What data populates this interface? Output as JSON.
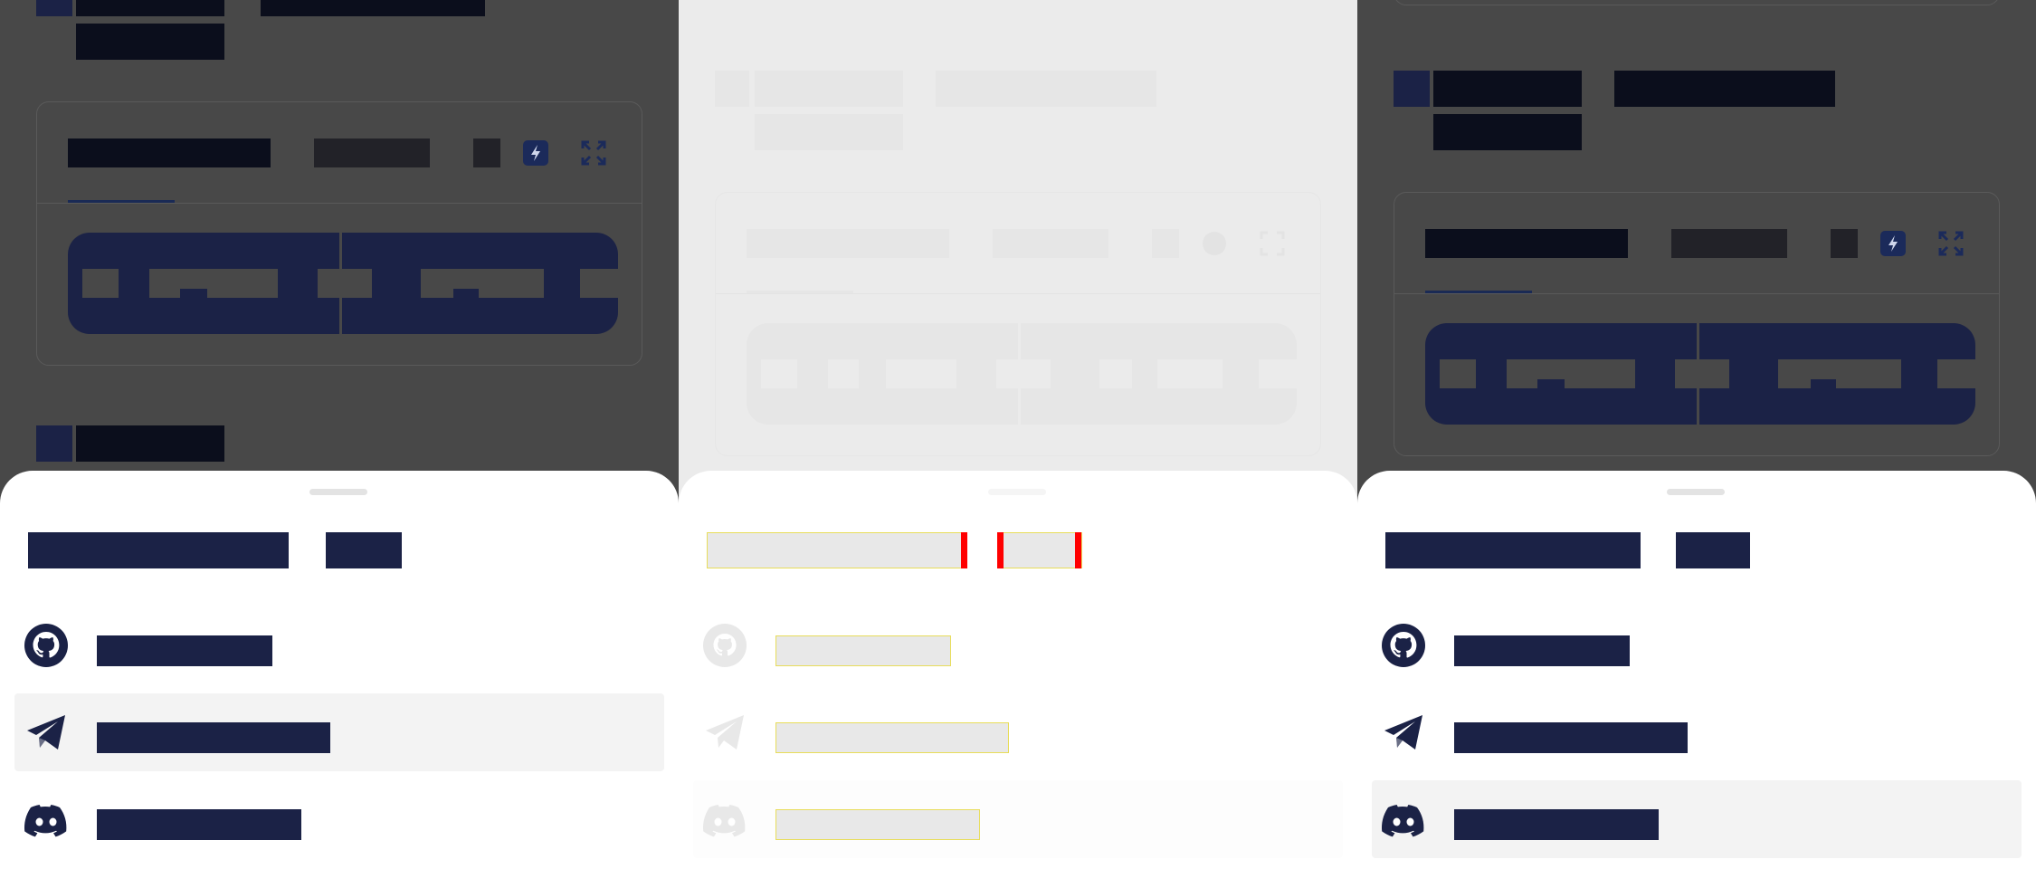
{
  "colors": {
    "overlay": "#484848",
    "sheet": "#ffffff",
    "navy": "#1b2246",
    "dark_block": "#0b0e1c",
    "ghost": "#ebebeb",
    "highlight_outline": "#e8dd5a",
    "marker_red": "#ff0000",
    "selected_row": "#f3f3f3"
  },
  "panels": [
    {
      "id": "panel-1",
      "selected_item": 1,
      "share_sheet": {
        "items": [
          {
            "icon": "github-icon"
          },
          {
            "icon": "telegram-icon"
          },
          {
            "icon": "discord-icon"
          }
        ]
      }
    },
    {
      "id": "panel-2",
      "selected_item": 2,
      "share_sheet": {
        "items": [
          {
            "icon": "github-icon"
          },
          {
            "icon": "telegram-icon"
          },
          {
            "icon": "discord-icon"
          }
        ]
      }
    },
    {
      "id": "panel-3",
      "selected_item": 2,
      "share_sheet": {
        "items": [
          {
            "icon": "github-icon"
          },
          {
            "icon": "telegram-icon"
          },
          {
            "icon": "discord-icon"
          }
        ]
      }
    }
  ],
  "icons": {
    "card_toolbar": [
      "square-icon",
      "bolt-icon",
      "expand-icon"
    ]
  }
}
